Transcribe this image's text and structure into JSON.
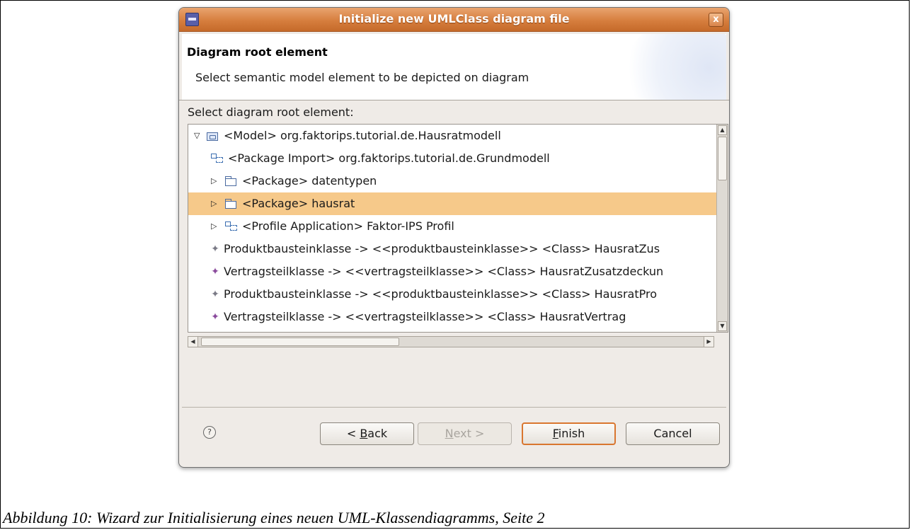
{
  "dialog": {
    "title": "Initialize new UMLClass diagram file",
    "close_label": "x"
  },
  "header": {
    "title": "Diagram root element",
    "description": "Select semantic model element to be depicted on diagram"
  },
  "tree": {
    "label": "Select diagram root element:",
    "rows": [
      {
        "arrow": "▽",
        "icon": "model-icon",
        "text": "<Model> org.faktorips.tutorial.de.Hausratmodell"
      },
      {
        "arrow": "",
        "icon": "package-import-icon",
        "text": "<Package Import> org.faktorips.tutorial.de.Grundmodell"
      },
      {
        "arrow": "▷",
        "icon": "package-icon",
        "text": "<Package> datentypen"
      },
      {
        "arrow": "▷",
        "icon": "package-icon",
        "text": "<Package> hausrat"
      },
      {
        "arrow": "▷",
        "icon": "profile-application-icon",
        "text": "<Profile Application> Faktor-IPS Profil"
      },
      {
        "arrow": "",
        "icon": "stereotype-icon",
        "text": "Produktbausteinklasse -> <<produktbausteinklasse>> <Class> HausratZus"
      },
      {
        "arrow": "",
        "icon": "stereotype-icon",
        "text": "Vertragsteilklasse -> <<vertragsteilklasse>> <Class> HausratZusatzdeckun"
      },
      {
        "arrow": "",
        "icon": "stereotype-icon",
        "text": "Produktbausteinklasse -> <<produktbausteinklasse>> <Class> HausratPro"
      },
      {
        "arrow": "",
        "icon": "stereotype-icon",
        "text": "Vertragsteilklasse -> <<vertragsteilklasse>> <Class> HausratVertrag"
      }
    ],
    "selected_index": 3
  },
  "buttons": {
    "help": "?",
    "back_prefix": "< ",
    "back_mnemonic": "B",
    "back_rest": "ack",
    "next_mnemonic": "N",
    "next_rest": "ext >",
    "finish_mnemonic": "F",
    "finish_rest": "inish",
    "cancel": "Cancel"
  },
  "caption": "Abbildung 10: Wizard zur Initialisierung eines neuen UML-Klassendiagramms, Seite 2",
  "colors": {
    "titlebar": "#d67e3e",
    "selection": "#f6c98a",
    "default_button_border": "#d9762f"
  }
}
